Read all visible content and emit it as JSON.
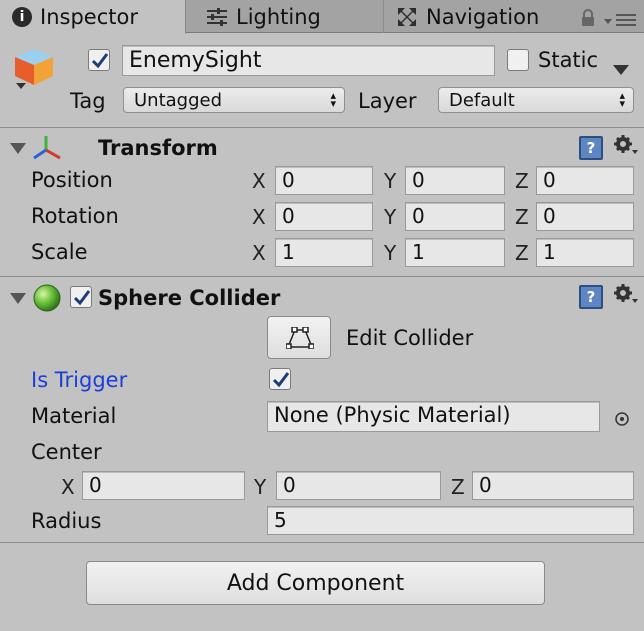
{
  "tabs": [
    {
      "label": "Inspector",
      "icon": "info-icon"
    },
    {
      "label": "Lighting",
      "icon": "sliders-icon"
    },
    {
      "label": "Navigation",
      "icon": "navigation-icon"
    }
  ],
  "object": {
    "active": true,
    "name": "EnemySight",
    "static_label": "Static",
    "static_checked": false,
    "tag_label": "Tag",
    "tag_value": "Untagged",
    "layer_label": "Layer",
    "layer_value": "Default"
  },
  "transform": {
    "title": "Transform",
    "rows": [
      {
        "label": "Position",
        "x": "0",
        "y": "0",
        "z": "0"
      },
      {
        "label": "Rotation",
        "x": "0",
        "y": "0",
        "z": "0"
      },
      {
        "label": "Scale",
        "x": "1",
        "y": "1",
        "z": "1"
      }
    ],
    "axes": {
      "x": "X",
      "y": "Y",
      "z": "Z"
    }
  },
  "sphere_collider": {
    "title": "Sphere Collider",
    "enabled": true,
    "edit_collider_label": "Edit Collider",
    "is_trigger_label": "Is Trigger",
    "is_trigger": true,
    "material_label": "Material",
    "material_value": "None (Physic Material)",
    "center_label": "Center",
    "center": {
      "x": "0",
      "y": "0",
      "z": "0"
    },
    "radius_label": "Radius",
    "radius_value": "5"
  },
  "add_component_label": "Add Component",
  "colors": {
    "panel_bg": "#c2c2c2",
    "tab_bar": "#a3a3a3",
    "is_trigger_text": "#1a3fd8",
    "help_icon": "#5d86c2"
  }
}
